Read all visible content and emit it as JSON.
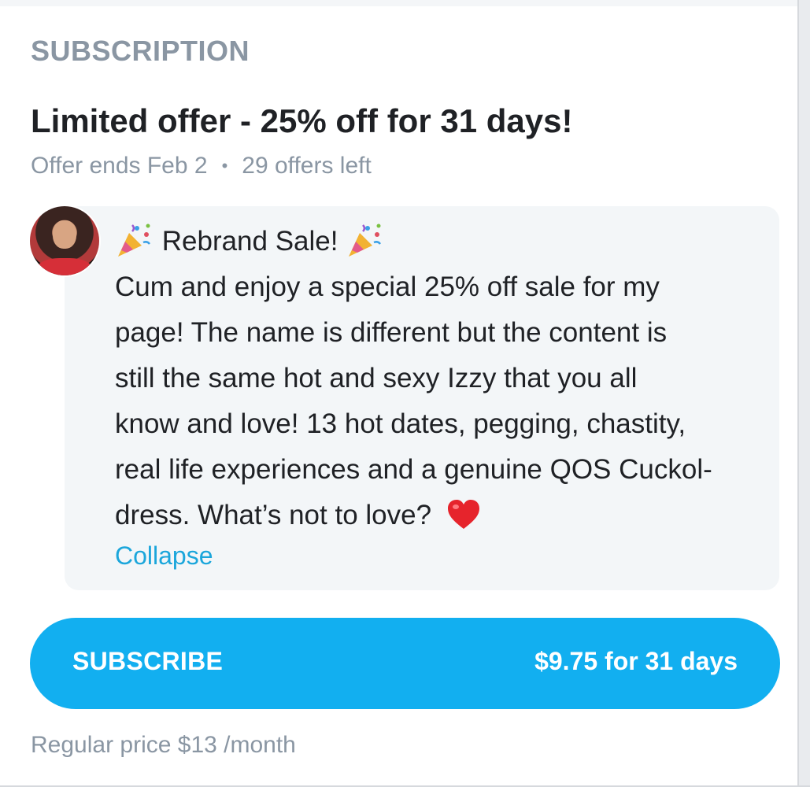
{
  "section": {
    "label": "SUBSCRIPTION"
  },
  "offer": {
    "title": "Limited offer - 25% off for 31 days!",
    "ends": "Offer ends Feb 2",
    "separator": "•",
    "remaining": "29 offers left"
  },
  "message": {
    "headline": "Rebrand Sale!",
    "icons": {
      "headline": "party-popper-icon",
      "closing": "red-heart-icon"
    },
    "lines": [
      "Cum and enjoy a special 25% off sale for my",
      "page! The name is different but the content is",
      "still the same hot and sexy Izzy that you all",
      "know and love! 13 hot dates, pegging, chastity,",
      "real life experiences and a genuine QOS Cuckol-",
      "dress. What’s not to love?"
    ],
    "collapse_label": "Collapse"
  },
  "subscribe": {
    "label": "SUBSCRIBE",
    "price": "$9.75 for 31 days"
  },
  "regular_price": "Regular price $13 /month",
  "colors": {
    "accent": "#12aff0",
    "link": "#1ba6db",
    "muted": "#8a96a3",
    "bubble": "#f3f6f8"
  }
}
